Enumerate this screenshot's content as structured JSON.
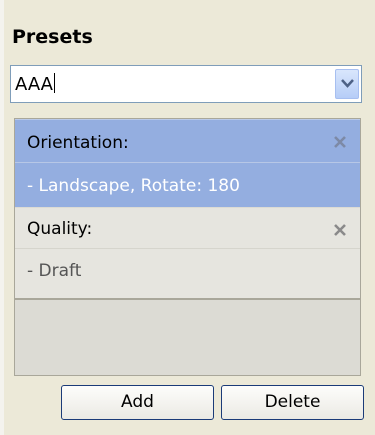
{
  "presets": {
    "title": "Presets",
    "combo_value": "AAA",
    "items": [
      {
        "label": "Orientation:",
        "value": "- Landscape, Rotate: 180",
        "selected": true
      },
      {
        "label": "Quality:",
        "value": "- Draft",
        "selected": false
      }
    ],
    "buttons": {
      "add": "Add",
      "delete": "Delete"
    }
  },
  "colors": {
    "selection": "#94aee0",
    "panel": "#ece9d8"
  }
}
